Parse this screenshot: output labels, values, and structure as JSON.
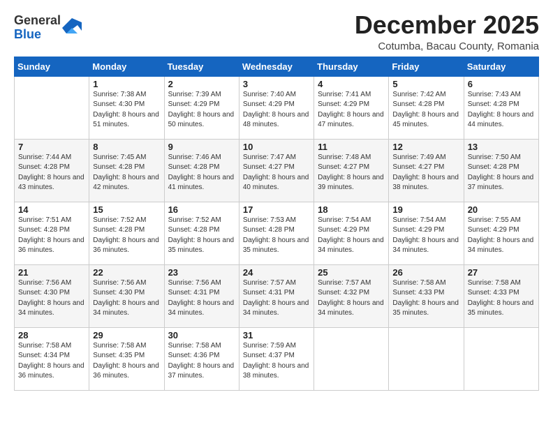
{
  "logo": {
    "general": "General",
    "blue": "Blue"
  },
  "header": {
    "month_title": "December 2025",
    "location": "Cotumba, Bacau County, Romania"
  },
  "weekdays": [
    "Sunday",
    "Monday",
    "Tuesday",
    "Wednesday",
    "Thursday",
    "Friday",
    "Saturday"
  ],
  "weeks": [
    [
      {
        "day": "",
        "sunrise": "",
        "sunset": "",
        "daylight": ""
      },
      {
        "day": "1",
        "sunrise": "Sunrise: 7:38 AM",
        "sunset": "Sunset: 4:30 PM",
        "daylight": "Daylight: 8 hours and 51 minutes."
      },
      {
        "day": "2",
        "sunrise": "Sunrise: 7:39 AM",
        "sunset": "Sunset: 4:29 PM",
        "daylight": "Daylight: 8 hours and 50 minutes."
      },
      {
        "day": "3",
        "sunrise": "Sunrise: 7:40 AM",
        "sunset": "Sunset: 4:29 PM",
        "daylight": "Daylight: 8 hours and 48 minutes."
      },
      {
        "day": "4",
        "sunrise": "Sunrise: 7:41 AM",
        "sunset": "Sunset: 4:29 PM",
        "daylight": "Daylight: 8 hours and 47 minutes."
      },
      {
        "day": "5",
        "sunrise": "Sunrise: 7:42 AM",
        "sunset": "Sunset: 4:28 PM",
        "daylight": "Daylight: 8 hours and 45 minutes."
      },
      {
        "day": "6",
        "sunrise": "Sunrise: 7:43 AM",
        "sunset": "Sunset: 4:28 PM",
        "daylight": "Daylight: 8 hours and 44 minutes."
      }
    ],
    [
      {
        "day": "7",
        "sunrise": "Sunrise: 7:44 AM",
        "sunset": "Sunset: 4:28 PM",
        "daylight": "Daylight: 8 hours and 43 minutes."
      },
      {
        "day": "8",
        "sunrise": "Sunrise: 7:45 AM",
        "sunset": "Sunset: 4:28 PM",
        "daylight": "Daylight: 8 hours and 42 minutes."
      },
      {
        "day": "9",
        "sunrise": "Sunrise: 7:46 AM",
        "sunset": "Sunset: 4:28 PM",
        "daylight": "Daylight: 8 hours and 41 minutes."
      },
      {
        "day": "10",
        "sunrise": "Sunrise: 7:47 AM",
        "sunset": "Sunset: 4:27 PM",
        "daylight": "Daylight: 8 hours and 40 minutes."
      },
      {
        "day": "11",
        "sunrise": "Sunrise: 7:48 AM",
        "sunset": "Sunset: 4:27 PM",
        "daylight": "Daylight: 8 hours and 39 minutes."
      },
      {
        "day": "12",
        "sunrise": "Sunrise: 7:49 AM",
        "sunset": "Sunset: 4:27 PM",
        "daylight": "Daylight: 8 hours and 38 minutes."
      },
      {
        "day": "13",
        "sunrise": "Sunrise: 7:50 AM",
        "sunset": "Sunset: 4:28 PM",
        "daylight": "Daylight: 8 hours and 37 minutes."
      }
    ],
    [
      {
        "day": "14",
        "sunrise": "Sunrise: 7:51 AM",
        "sunset": "Sunset: 4:28 PM",
        "daylight": "Daylight: 8 hours and 36 minutes."
      },
      {
        "day": "15",
        "sunrise": "Sunrise: 7:52 AM",
        "sunset": "Sunset: 4:28 PM",
        "daylight": "Daylight: 8 hours and 36 minutes."
      },
      {
        "day": "16",
        "sunrise": "Sunrise: 7:52 AM",
        "sunset": "Sunset: 4:28 PM",
        "daylight": "Daylight: 8 hours and 35 minutes."
      },
      {
        "day": "17",
        "sunrise": "Sunrise: 7:53 AM",
        "sunset": "Sunset: 4:28 PM",
        "daylight": "Daylight: 8 hours and 35 minutes."
      },
      {
        "day": "18",
        "sunrise": "Sunrise: 7:54 AM",
        "sunset": "Sunset: 4:29 PM",
        "daylight": "Daylight: 8 hours and 34 minutes."
      },
      {
        "day": "19",
        "sunrise": "Sunrise: 7:54 AM",
        "sunset": "Sunset: 4:29 PM",
        "daylight": "Daylight: 8 hours and 34 minutes."
      },
      {
        "day": "20",
        "sunrise": "Sunrise: 7:55 AM",
        "sunset": "Sunset: 4:29 PM",
        "daylight": "Daylight: 8 hours and 34 minutes."
      }
    ],
    [
      {
        "day": "21",
        "sunrise": "Sunrise: 7:56 AM",
        "sunset": "Sunset: 4:30 PM",
        "daylight": "Daylight: 8 hours and 34 minutes."
      },
      {
        "day": "22",
        "sunrise": "Sunrise: 7:56 AM",
        "sunset": "Sunset: 4:30 PM",
        "daylight": "Daylight: 8 hours and 34 minutes."
      },
      {
        "day": "23",
        "sunrise": "Sunrise: 7:56 AM",
        "sunset": "Sunset: 4:31 PM",
        "daylight": "Daylight: 8 hours and 34 minutes."
      },
      {
        "day": "24",
        "sunrise": "Sunrise: 7:57 AM",
        "sunset": "Sunset: 4:31 PM",
        "daylight": "Daylight: 8 hours and 34 minutes."
      },
      {
        "day": "25",
        "sunrise": "Sunrise: 7:57 AM",
        "sunset": "Sunset: 4:32 PM",
        "daylight": "Daylight: 8 hours and 34 minutes."
      },
      {
        "day": "26",
        "sunrise": "Sunrise: 7:58 AM",
        "sunset": "Sunset: 4:33 PM",
        "daylight": "Daylight: 8 hours and 35 minutes."
      },
      {
        "day": "27",
        "sunrise": "Sunrise: 7:58 AM",
        "sunset": "Sunset: 4:33 PM",
        "daylight": "Daylight: 8 hours and 35 minutes."
      }
    ],
    [
      {
        "day": "28",
        "sunrise": "Sunrise: 7:58 AM",
        "sunset": "Sunset: 4:34 PM",
        "daylight": "Daylight: 8 hours and 36 minutes."
      },
      {
        "day": "29",
        "sunrise": "Sunrise: 7:58 AM",
        "sunset": "Sunset: 4:35 PM",
        "daylight": "Daylight: 8 hours and 36 minutes."
      },
      {
        "day": "30",
        "sunrise": "Sunrise: 7:58 AM",
        "sunset": "Sunset: 4:36 PM",
        "daylight": "Daylight: 8 hours and 37 minutes."
      },
      {
        "day": "31",
        "sunrise": "Sunrise: 7:59 AM",
        "sunset": "Sunset: 4:37 PM",
        "daylight": "Daylight: 8 hours and 38 minutes."
      },
      {
        "day": "",
        "sunrise": "",
        "sunset": "",
        "daylight": ""
      },
      {
        "day": "",
        "sunrise": "",
        "sunset": "",
        "daylight": ""
      },
      {
        "day": "",
        "sunrise": "",
        "sunset": "",
        "daylight": ""
      }
    ]
  ]
}
